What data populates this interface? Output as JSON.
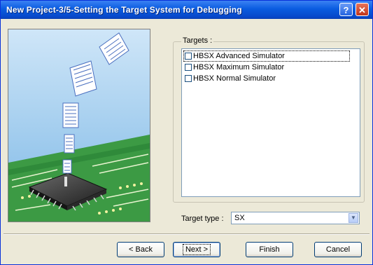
{
  "window": {
    "title": "New Project-3/5-Setting the Target System for Debugging",
    "help_glyph": "?",
    "close_glyph": "✕"
  },
  "targets": {
    "group_label": "Targets :",
    "items": [
      {
        "label": "HBSX Advanced Simulator",
        "checked": false
      },
      {
        "label": "HBSX Maximum Simulator",
        "checked": false
      },
      {
        "label": "HBSX Normal Simulator",
        "checked": false
      }
    ]
  },
  "target_type": {
    "label": "Target type :",
    "value": "SX",
    "arrow_glyph": "▼"
  },
  "buttons": {
    "back": "< Back",
    "next": "Next >",
    "finish": "Finish",
    "cancel": "Cancel"
  },
  "colors": {
    "title_bar": "#0a5ce0",
    "window_bg": "#ece9d8",
    "close_button": "#c0341a",
    "pcb_green": "#3c9a44",
    "sky_blue": "#a8d0f0"
  },
  "icons": [
    "help-icon",
    "close-icon",
    "chevron-down-icon"
  ]
}
